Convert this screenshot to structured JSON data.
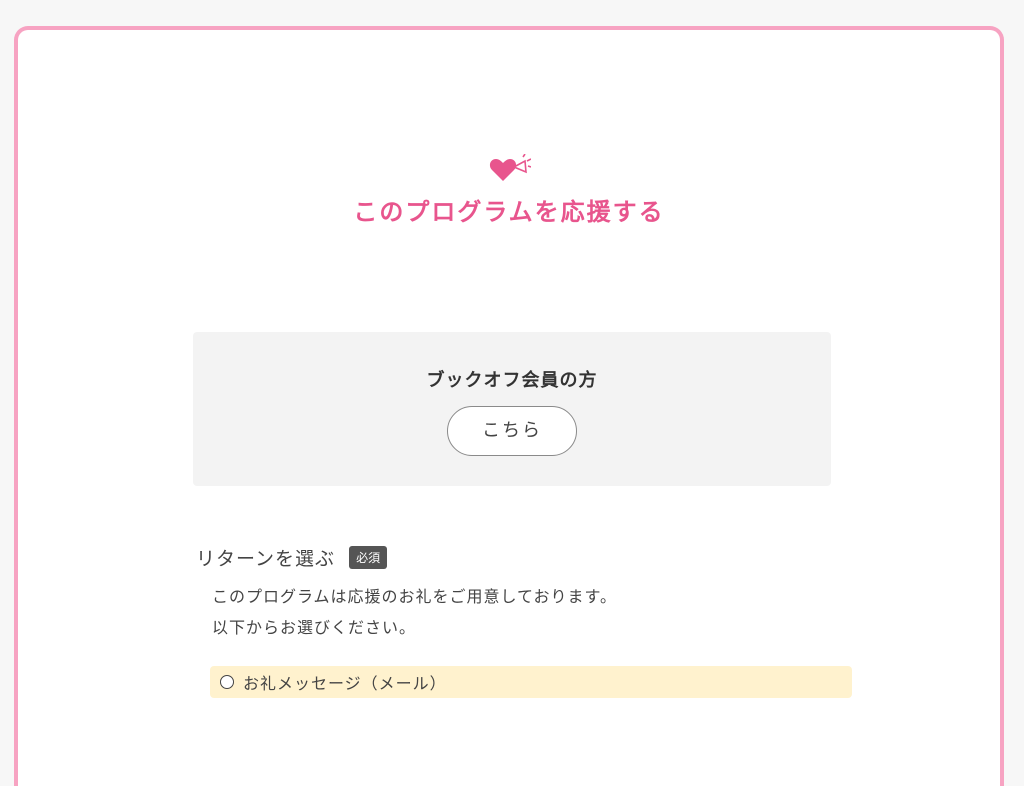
{
  "colors": {
    "accent": "#e8558d",
    "frame_border": "#f7a3c2",
    "member_box_bg": "#f3f3f3",
    "option_bg": "#fff2ce",
    "badge_bg": "#555555"
  },
  "header": {
    "icon": "heart-megaphone-icon",
    "title": "このプログラムを応援する"
  },
  "member": {
    "title": "ブックオフ会員の方",
    "button_label": "こちら"
  },
  "return_section": {
    "label": "リターンを選ぶ",
    "required_badge": "必須",
    "description_line1": "このプログラムは応援のお礼をご用意しております。",
    "description_line2": "以下からお選びください。",
    "options": [
      {
        "label": "お礼メッセージ（メール）",
        "selected": false
      }
    ]
  }
}
